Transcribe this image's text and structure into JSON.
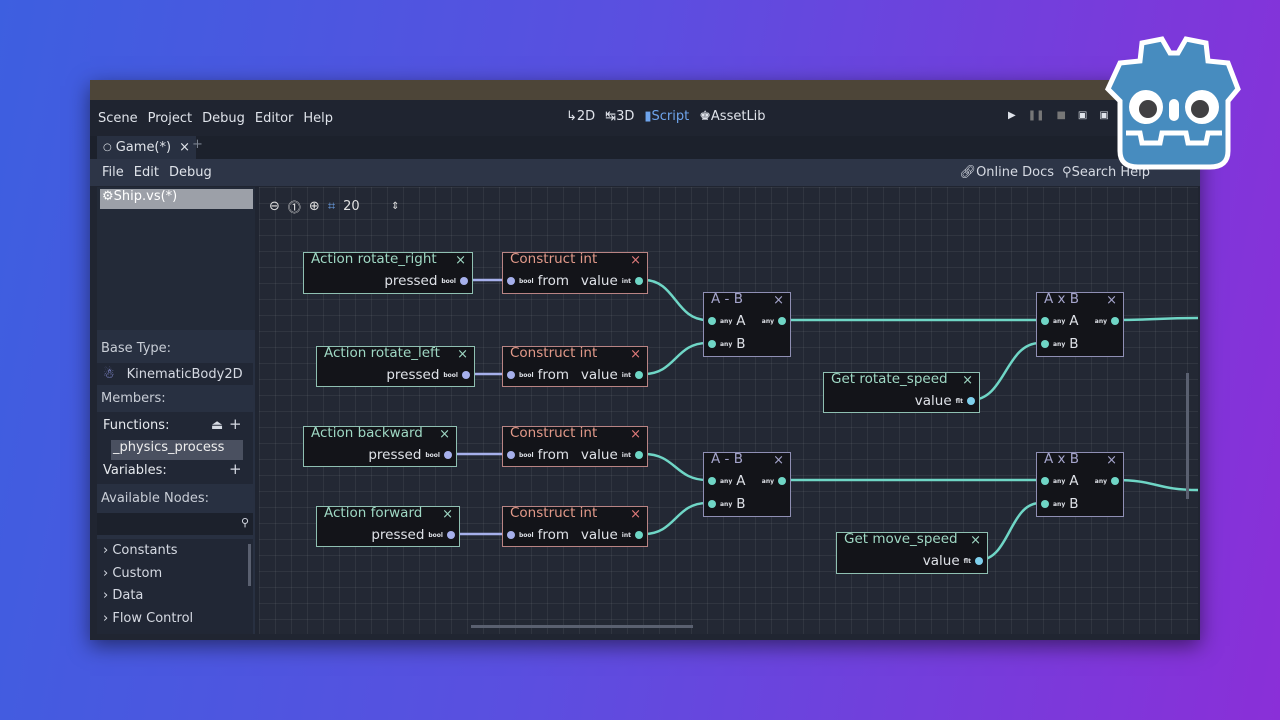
{
  "menu": [
    "Scene",
    "Project",
    "Debug",
    "Editor",
    "Help"
  ],
  "workspaces": [
    {
      "icon": "2d-icon",
      "glyph": "⮤",
      "label": "2D"
    },
    {
      "icon": "3d-icon",
      "glyph": "⮤",
      "label": "3D"
    },
    {
      "icon": "script-icon",
      "glyph": "▮",
      "label": "Script",
      "active": true
    },
    {
      "icon": "assetlib-icon",
      "glyph": "⌂",
      "label": "AssetLib"
    }
  ],
  "accent": "#6ea4ec",
  "scene_tab": {
    "label": "Game(*)",
    "close": "×",
    "add": "+"
  },
  "script_menu": [
    "File",
    "Edit",
    "Debug"
  ],
  "help": {
    "docs": "Online Docs",
    "search": "Search Help"
  },
  "script_list": [
    "Ship.vs(*)"
  ],
  "graph_toolbar": {
    "zoom": "20"
  },
  "panel": {
    "base_type_label": "Base Type:",
    "base_type": "KinematicBody2D",
    "members_label": "Members:",
    "functions_label": "Functions:",
    "functions": [
      "_physics_process"
    ],
    "variables_label": "Variables:",
    "available_label": "Available Nodes:",
    "search_placeholder": "",
    "categories": [
      "Constants",
      "Custom",
      "Data",
      "Flow Control"
    ]
  },
  "nodes": [
    {
      "id": "n1",
      "type": "action",
      "title": "Action rotate_right",
      "out": "pressed",
      "out_type": "bool"
    },
    {
      "id": "n2",
      "type": "construct",
      "title": "Construct int",
      "in": "from",
      "in_type": "bool",
      "out": "value",
      "out_type": "int"
    },
    {
      "id": "n3",
      "type": "op",
      "title": "A - B",
      "a": "A",
      "b": "B",
      "t": "any"
    },
    {
      "id": "n4",
      "type": "action",
      "title": "Action rotate_left",
      "out": "pressed",
      "out_type": "bool"
    },
    {
      "id": "n5",
      "type": "construct",
      "title": "Construct int",
      "in": "from",
      "in_type": "bool",
      "out": "value",
      "out_type": "int"
    },
    {
      "id": "n6",
      "type": "get",
      "title": "Get rotate_speed",
      "out": "value",
      "out_type": "flt"
    },
    {
      "id": "n7",
      "type": "op",
      "title": "A x B",
      "a": "A",
      "b": "B",
      "t": "any"
    },
    {
      "id": "n8",
      "type": "action",
      "title": "Action backward",
      "out": "pressed",
      "out_type": "bool"
    },
    {
      "id": "n9",
      "type": "construct",
      "title": "Construct int",
      "in": "from",
      "in_type": "bool",
      "out": "value",
      "out_type": "int"
    },
    {
      "id": "n10",
      "type": "op",
      "title": "A - B",
      "a": "A",
      "b": "B",
      "t": "any"
    },
    {
      "id": "n11",
      "type": "action",
      "title": "Action forward",
      "out": "pressed",
      "out_type": "bool"
    },
    {
      "id": "n12",
      "type": "construct",
      "title": "Construct int",
      "in": "from",
      "in_type": "bool",
      "out": "value",
      "out_type": "int"
    },
    {
      "id": "n13",
      "type": "op",
      "title": "A x B",
      "a": "A",
      "b": "B",
      "t": "any"
    },
    {
      "id": "n14",
      "type": "get",
      "title": "Get move_speed",
      "out": "value",
      "out_type": "flt"
    }
  ],
  "colors": {
    "bool_wire": "#a6b0ec",
    "any_wire": "#6fd6c6"
  }
}
